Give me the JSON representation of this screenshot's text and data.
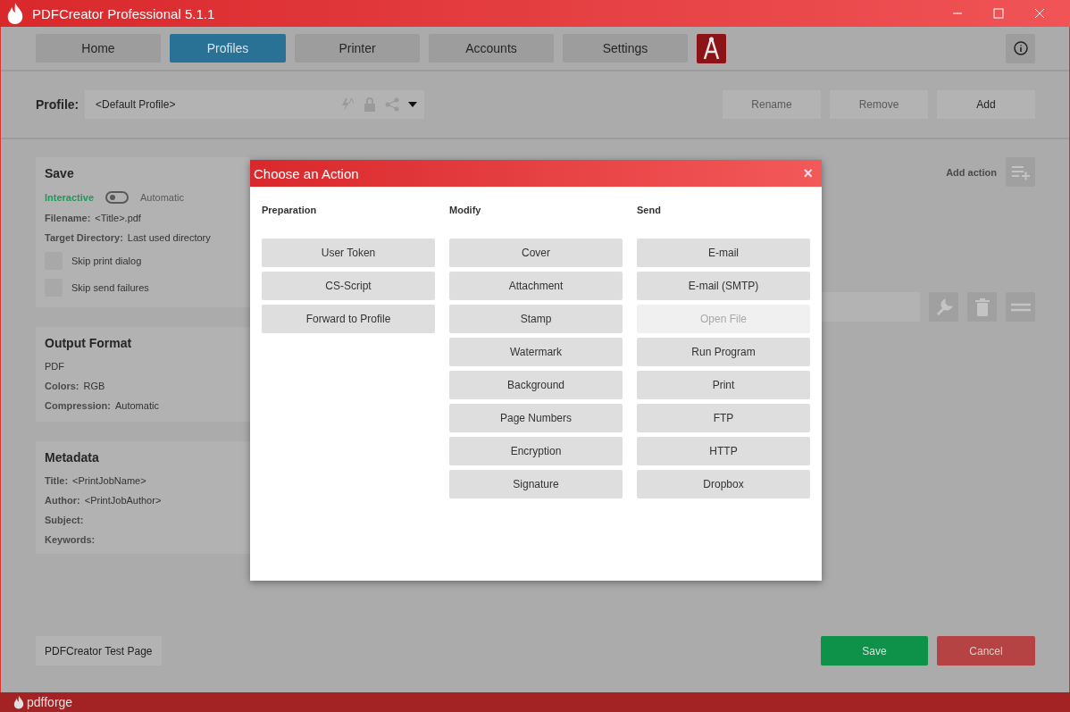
{
  "window": {
    "title": "PDFCreator Professional 5.1.1"
  },
  "tabs": [
    {
      "label": "Home",
      "selected": false
    },
    {
      "label": "Profiles",
      "selected": true
    },
    {
      "label": "Printer",
      "selected": false
    },
    {
      "label": "Accounts",
      "selected": false
    },
    {
      "label": "Settings",
      "selected": false
    }
  ],
  "profile": {
    "label": "Profile:",
    "value": "<Default Profile>",
    "buttons": [
      "Rename",
      "Remove",
      "Add"
    ]
  },
  "save_card": {
    "title": "Save",
    "mode_left": "Interactive",
    "mode_right": "Automatic",
    "automatic": false,
    "fields": [
      {
        "label": "Filename:",
        "value": "<Title>.pdf"
      },
      {
        "label": "Target Directory:",
        "value": "Last used directory"
      }
    ],
    "checkboxes": [
      {
        "label": "Skip print dialog",
        "checked": false
      },
      {
        "label": "Skip send failures",
        "checked": false
      }
    ]
  },
  "output_card": {
    "title": "Output Format",
    "format": "PDF",
    "fields": [
      {
        "label": "Colors:",
        "value": "RGB"
      },
      {
        "label": "Compression:",
        "value": "Automatic"
      }
    ]
  },
  "metadata_card": {
    "title": "Metadata",
    "fields": [
      {
        "label": "Title:",
        "value": "<PrintJobName>"
      },
      {
        "label": "Author:",
        "value": "<PrintJobAuthor>"
      },
      {
        "label": "Subject:"
      },
      {
        "label": "Keywords:"
      }
    ]
  },
  "actions": {
    "add_label": "Add action"
  },
  "test_page_button": "PDFCreator Test Page",
  "footer_buttons": [
    {
      "label": "Save",
      "kind": "primary"
    },
    {
      "label": "Cancel",
      "kind": "danger"
    }
  ],
  "footer": {
    "brand": "pdfforge"
  },
  "dialog": {
    "title": "Choose an Action",
    "close": "×",
    "columns": [
      {
        "heading": "Preparation",
        "items": [
          {
            "label": "User Token",
            "disabled": false
          },
          {
            "label": "CS-Script",
            "disabled": false
          },
          {
            "label": "Forward to Profile",
            "disabled": false
          }
        ]
      },
      {
        "heading": "Modify",
        "items": [
          {
            "label": "Cover",
            "disabled": false
          },
          {
            "label": "Attachment",
            "disabled": false
          },
          {
            "label": "Stamp",
            "disabled": false
          },
          {
            "label": "Watermark",
            "disabled": false
          },
          {
            "label": "Background",
            "disabled": false
          },
          {
            "label": "Page Numbers",
            "disabled": false
          },
          {
            "label": "Encryption",
            "disabled": false
          },
          {
            "label": "Signature",
            "disabled": false
          }
        ]
      },
      {
        "heading": "Send",
        "items": [
          {
            "label": "E-mail",
            "disabled": false
          },
          {
            "label": "E-mail (SMTP)",
            "disabled": false
          },
          {
            "label": "Open File",
            "disabled": true
          },
          {
            "label": "Run Program",
            "disabled": false
          },
          {
            "label": "Print",
            "disabled": false
          },
          {
            "label": "FTP",
            "disabled": false
          },
          {
            "label": "HTTP",
            "disabled": false
          },
          {
            "label": "Dropbox",
            "disabled": false
          }
        ]
      }
    ]
  }
}
